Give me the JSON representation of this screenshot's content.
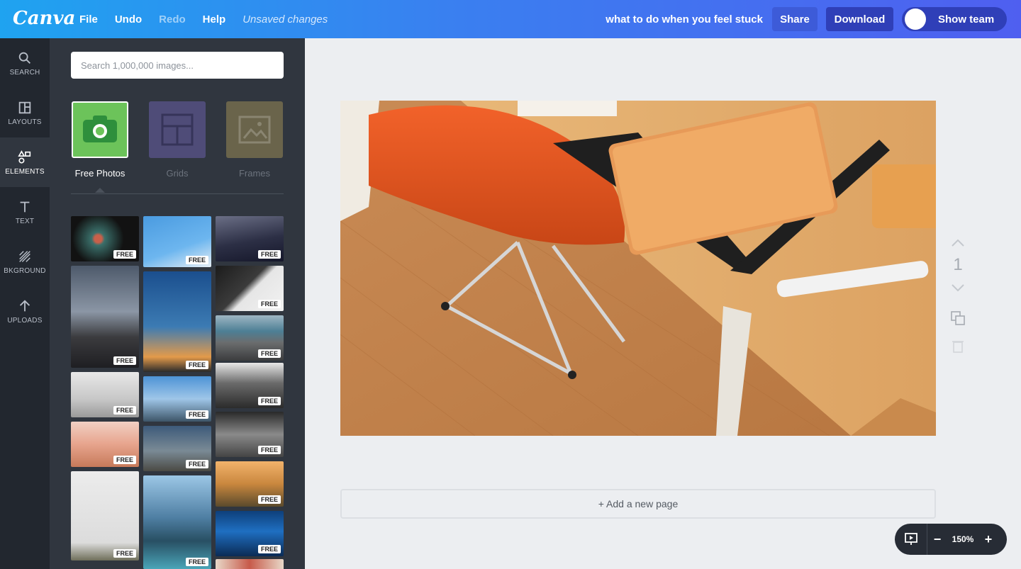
{
  "app": {
    "logo": "Canva"
  },
  "menu": {
    "file": "File",
    "undo": "Undo",
    "redo": "Redo",
    "help": "Help",
    "status": "Unsaved changes"
  },
  "header": {
    "doc_title": "what to do when you feel stuck",
    "share": "Share",
    "download": "Download",
    "show_team": "Show team"
  },
  "rail": [
    {
      "label": "SEARCH",
      "icon": "search-icon"
    },
    {
      "label": "LAYOUTS",
      "icon": "layouts-icon"
    },
    {
      "label": "ELEMENTS",
      "icon": "elements-icon"
    },
    {
      "label": "TEXT",
      "icon": "text-icon"
    },
    {
      "label": "BKGROUND",
      "icon": "background-icon"
    },
    {
      "label": "UPLOADS",
      "icon": "uploads-icon"
    }
  ],
  "panel": {
    "search_placeholder": "Search 1,000,000 images...",
    "categories": [
      {
        "label": "Free Photos",
        "color": "#6cc35a"
      },
      {
        "label": "Grids",
        "color": "#6a5fa8"
      },
      {
        "label": "Frames",
        "color": "#9a8a55"
      }
    ],
    "badge": "FREE"
  },
  "canvas": {
    "page_number": "1",
    "add_page": "+ Add a new page"
  },
  "zoom": {
    "level": "150%",
    "minus": "−",
    "plus": "+"
  }
}
